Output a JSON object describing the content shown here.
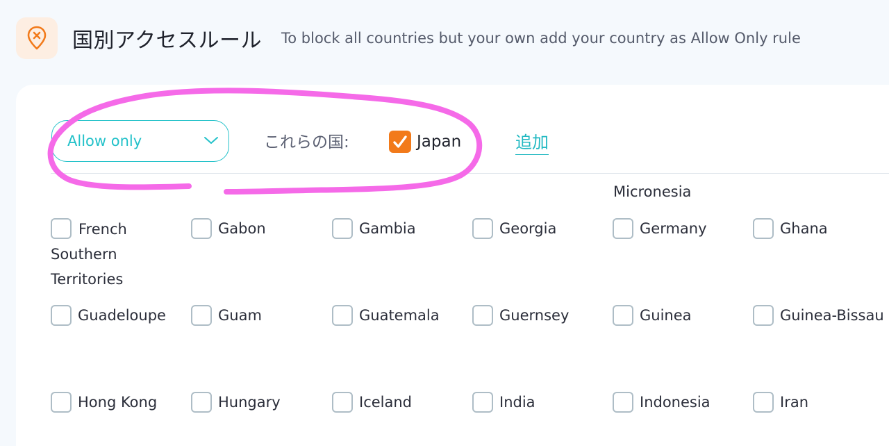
{
  "header": {
    "title": "国別アクセスルール",
    "subtitle": "To block all countries but your own add your country as Allow Only rule",
    "icon": "map-pin-blocked-icon",
    "icon_color": "#f27a1a"
  },
  "rule": {
    "mode_value": "Allow only",
    "countries_label": "これらの国:",
    "selected_countries": [
      "Japan"
    ],
    "add_label": "追加"
  },
  "accent_color": "#22c1c9",
  "checked_color": "#f27a1a",
  "annotation_color": "#f56ae8",
  "country_list": {
    "partial_label": "Micronesia",
    "rows": [
      [
        "French Southern Territories",
        "Gabon",
        "Gambia",
        "Georgia",
        "Germany",
        "Ghana"
      ],
      [
        "Guadeloupe",
        "Guam",
        "Guatemala",
        "Guernsey",
        "Guinea",
        "Guinea-Bissau"
      ],
      [
        "Hong Kong",
        "Hungary",
        "Iceland",
        "India",
        "Indonesia",
        "Iran"
      ]
    ]
  }
}
